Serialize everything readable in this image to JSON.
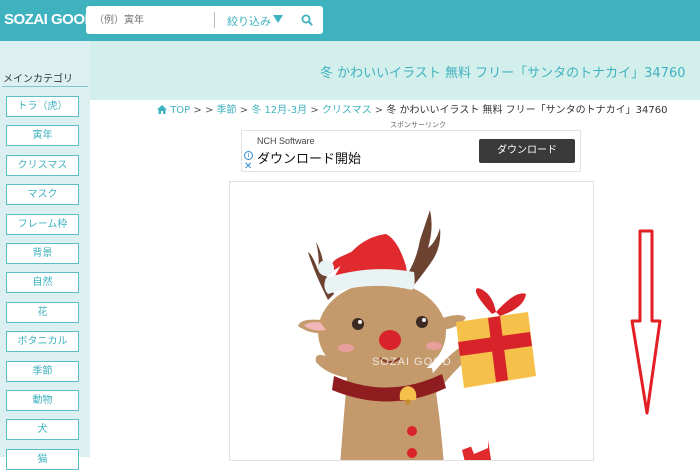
{
  "header": {
    "logo": "SOZAI GOOD",
    "search_placeholder": "（例）寅年",
    "filter_label": "絞り込み"
  },
  "sidebar": {
    "title": "メインカテゴリ",
    "items": [
      "トラ（虎）",
      "寅年",
      "クリスマス",
      "マスク",
      "フレーム枠",
      "背景",
      "自然",
      "花",
      "ボタニカル",
      "季節",
      "動物",
      "犬",
      "猫"
    ]
  },
  "banner": {
    "title": "冬 かわいいイラスト 無料 フリー「サンタのトナカイ」34760"
  },
  "breadcrumb": {
    "items": [
      "TOP",
      "",
      "季節",
      "冬 12月-3月",
      "クリスマス"
    ],
    "current": "冬 かわいいイラスト 無料 フリー「サンタのトナカイ」34760"
  },
  "sponsor_label": "スポンサーリンク",
  "ad": {
    "vendor": "NCH Software",
    "headline": "ダウンロード開始",
    "button": "ダウンロード",
    "info_icon": "i",
    "close_icon": "✕"
  },
  "image": {
    "watermark": "SOZAI GOOD",
    "alt": "サンタのトナカイ"
  },
  "colors": {
    "accent": "#3fb2bf",
    "banner_bg": "#d3efec",
    "sidebar_bg": "#dcf0f1",
    "arrow": "#e31e24"
  }
}
